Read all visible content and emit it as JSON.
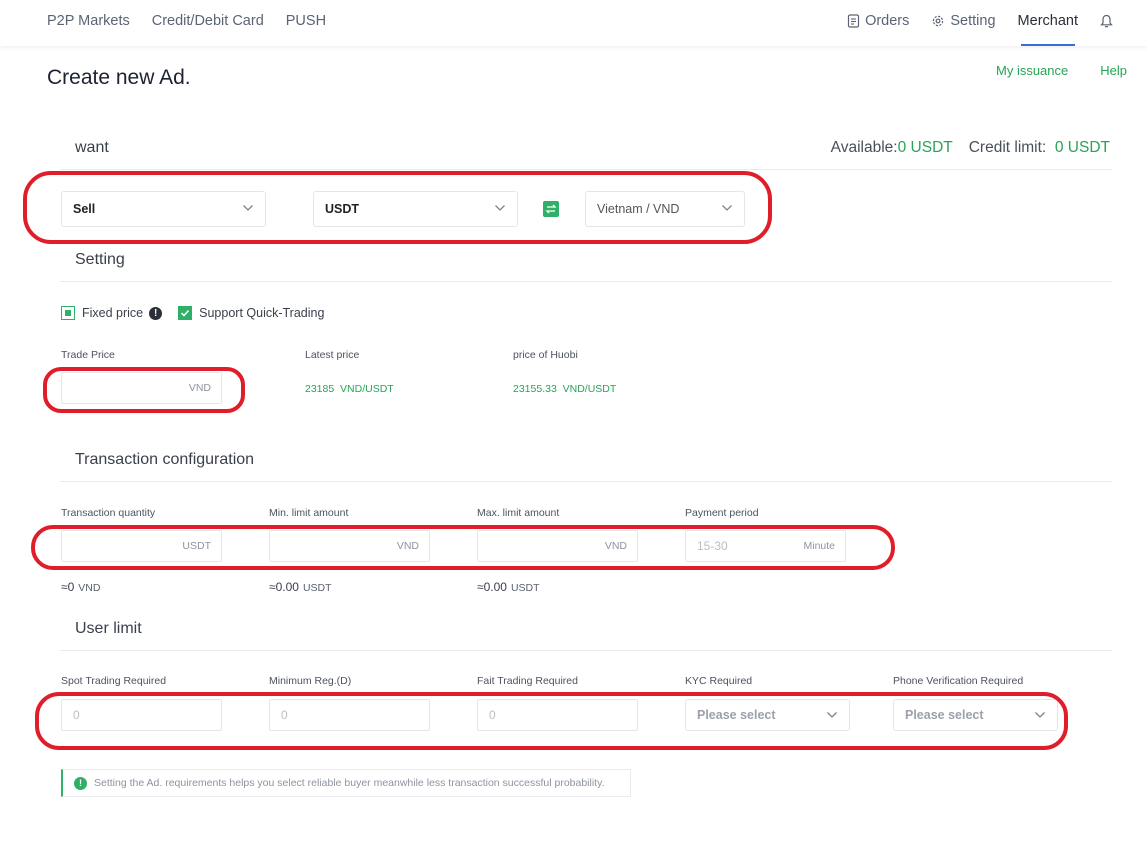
{
  "nav": {
    "left": [
      "P2P Markets",
      "Credit/Debit Card",
      "PUSH"
    ],
    "orders": "Orders",
    "setting": "Setting",
    "merchant": "Merchant"
  },
  "header": {
    "title": "Create new Ad.",
    "my_issuance": "My issuance",
    "help": "Help"
  },
  "want": {
    "title": "want",
    "available_label": "Available:",
    "available_value": "0 USDT",
    "credit_label": "Credit limit:",
    "credit_value": "0 USDT",
    "side": "Sell",
    "coin": "USDT",
    "fiat": "Vietnam / VND"
  },
  "setting": {
    "title": "Setting",
    "fixed_price": "Fixed price",
    "quick_trading": "Support Quick-Trading",
    "trade_price_label": "Trade Price",
    "trade_price_unit": "VND",
    "latest_price_label": "Latest price",
    "latest_price_value": "23185  VND/USDT",
    "huobi_price_label": "price of Huobi",
    "huobi_price_value": "23155.33  VND/USDT"
  },
  "transaction": {
    "title": "Transaction configuration",
    "qty_label": "Transaction quantity",
    "qty_unit": "USDT",
    "min_label": "Min. limit amount",
    "min_unit": "VND",
    "max_label": "Max. limit amount",
    "max_unit": "VND",
    "period_label": "Payment period",
    "period_placeholder": "15-30",
    "period_unit": "Minute",
    "approx_qty": "≈0",
    "approx_qty_unit": "VND",
    "approx_min": "≈0.00",
    "approx_min_unit": "USDT",
    "approx_max": "≈0.00",
    "approx_max_unit": "USDT"
  },
  "user_limit": {
    "title": "User limit",
    "spot_label": "Spot Trading Required",
    "spot_placeholder": "0",
    "reg_label": "Minimum Reg.(D)",
    "reg_placeholder": "0",
    "fiat_label": "Fait Trading Required",
    "fiat_placeholder": "0",
    "kyc_label": "KYC Required",
    "kyc_placeholder": "Please select",
    "phone_label": "Phone Verification Required",
    "phone_placeholder": "Please select"
  },
  "tip": "Setting the Ad. requirements helps you select reliable buyer meanwhile less transaction successful probability.",
  "colors": {
    "accent_green": "#27a456",
    "annotation_red": "#e01e2b",
    "nav_underline": "#3d6bd6"
  }
}
